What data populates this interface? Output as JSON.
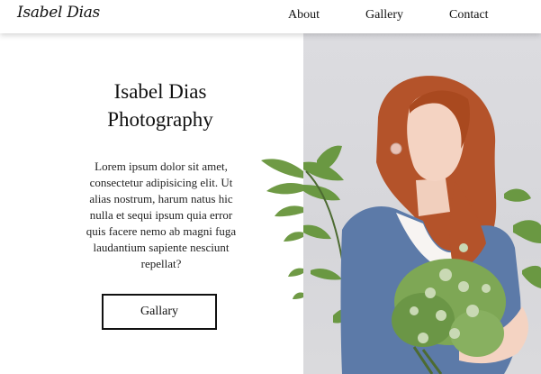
{
  "brand": {
    "name": "Isabel Dias"
  },
  "nav": {
    "about": "About",
    "gallery": "Gallery",
    "contact": "Contact"
  },
  "hero": {
    "title_line1": "Isabel Dias",
    "title_line2": "Photography",
    "text_lines": [
      "Lorem ipsum dolor sit amet,",
      "consectetur adipisicing elit. Ut",
      "alias nostrum, harum natus hic",
      "nulla et sequi ipsum quia error",
      "quis facere nemo ab magni fuga",
      "laudantium sapiente nesciunt",
      "repellat?"
    ],
    "button_label": "Gallary"
  },
  "colors": {
    "photo_background": "#d8d8dc",
    "hair": "#b4532a",
    "sweater": "#5c7aa8",
    "leaves": "#6f9a45"
  },
  "icons": {
    "photo": "portrait-photo"
  }
}
